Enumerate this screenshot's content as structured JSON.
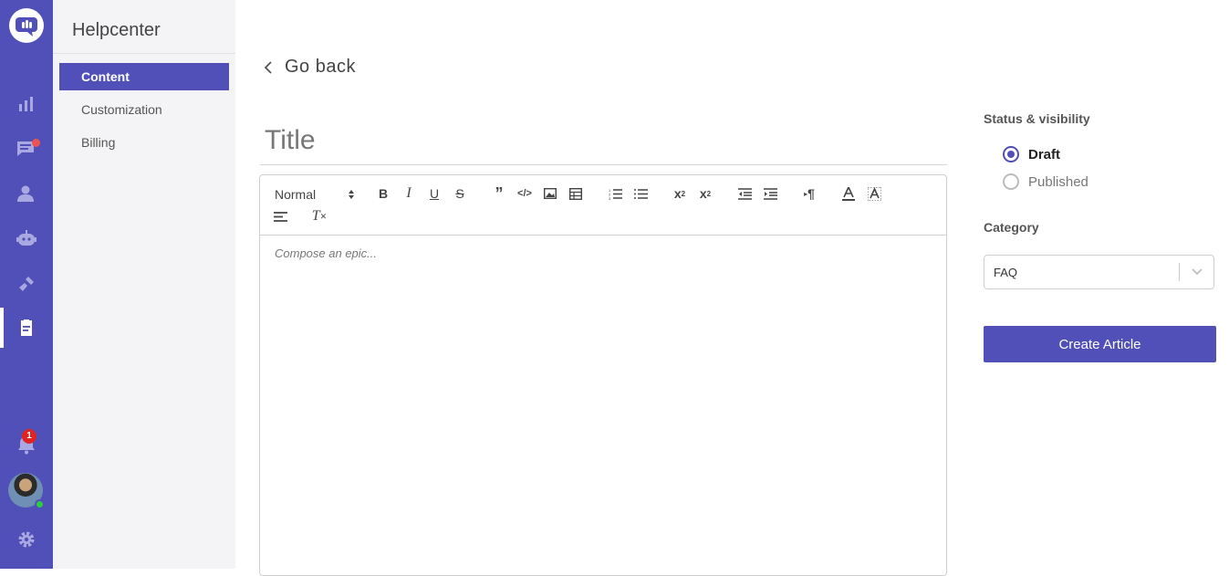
{
  "colors": {
    "primary": "#5150b8",
    "sidebar_bg": "#f4f4f6",
    "notification_red": "#e02424"
  },
  "rail": {
    "icons": [
      "chat-logo-icon",
      "analytics-icon",
      "conversations-icon",
      "contacts-icon",
      "bot-icon",
      "integrations-icon",
      "helpcenter-icon",
      "notifications-icon",
      "settings-icon"
    ],
    "notification_count": "1"
  },
  "sidebar": {
    "heading": "Helpcenter",
    "items": [
      {
        "label": "Content"
      },
      {
        "label": "Customization"
      },
      {
        "label": "Billing"
      }
    ]
  },
  "main": {
    "go_back": "Go back",
    "title_placeholder": "Title",
    "editor": {
      "format_select": "Normal",
      "placeholder": "Compose an epic..."
    }
  },
  "panel": {
    "status_label": "Status & visibility",
    "status_options": [
      {
        "label": "Draft",
        "selected": true
      },
      {
        "label": "Published",
        "selected": false
      }
    ],
    "category_label": "Category",
    "category_value": "FAQ",
    "create_button": "Create Article"
  }
}
